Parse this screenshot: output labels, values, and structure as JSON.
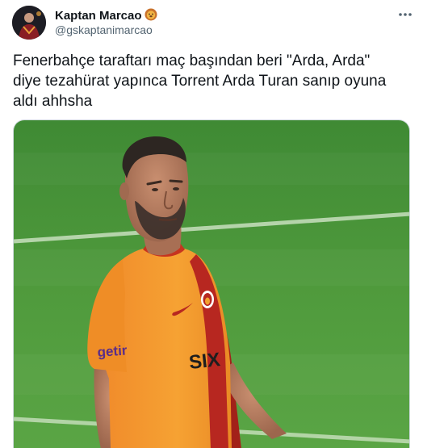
{
  "author": {
    "display_name": "Kaptan Marcao",
    "name_emoji": "lion-face-emoji",
    "handle": "@gskaptanimarcao"
  },
  "tweet": {
    "text": "Fenerbahçe taraftarı maç başından beri \"Arda, Arda\"\ndiye tezahürat yapınca Torrent Arda Turan sanıp oyuna\naldı ahhsha"
  },
  "media": {
    "type": "photo",
    "jersey_sponsor_left": "getir",
    "jersey_sponsor_right": "SIX",
    "colors": {
      "pitch": "#4f9a3c",
      "jersey_orange": "#f39a27",
      "jersey_red": "#b72720"
    }
  },
  "colors": {
    "text_primary": "#0f1419",
    "text_secondary": "#536471",
    "border": "#cfd9de"
  }
}
